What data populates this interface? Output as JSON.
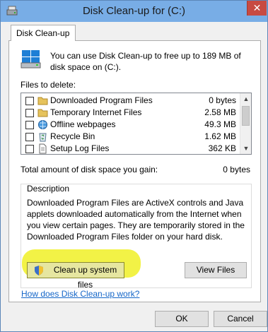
{
  "window": {
    "title": "Disk Clean-up for  (C:)",
    "close_label": "✕"
  },
  "tab": {
    "label": "Disk Clean-up"
  },
  "intro": {
    "text": "You can use Disk Clean-up to free up to 189 MB of disk space on  (C:)."
  },
  "files": {
    "label": "Files to delete:",
    "items": [
      {
        "name": "Downloaded Program Files",
        "size": "0 bytes",
        "icon": "folder-icon",
        "checked": false
      },
      {
        "name": "Temporary Internet Files",
        "size": "2.58 MB",
        "icon": "folder-icon",
        "checked": false
      },
      {
        "name": "Offline webpages",
        "size": "49.3 MB",
        "icon": "offline-webpage-icon",
        "checked": false
      },
      {
        "name": "Recycle Bin",
        "size": "1.62 MB",
        "icon": "recycle-bin-icon",
        "checked": false
      },
      {
        "name": "Setup Log Files",
        "size": "362 KB",
        "icon": "document-icon",
        "checked": false
      }
    ]
  },
  "total": {
    "label": "Total amount of disk space you gain:",
    "value": "0 bytes"
  },
  "description": {
    "title": "Description",
    "text": "Downloaded Program Files are ActiveX controls and Java applets downloaded automatically from the Internet when you view certain pages. They are temporarily stored in the Downloaded Program Files folder on your hard disk."
  },
  "buttons": {
    "cleanup_system": "Clean up system files",
    "view_files": "View Files",
    "ok": "OK",
    "cancel": "Cancel"
  },
  "help_link": "How does Disk Clean-up work?",
  "colors": {
    "titlebar": "#78ade6",
    "highlight": "#f1f13c",
    "link": "#1466c8"
  }
}
